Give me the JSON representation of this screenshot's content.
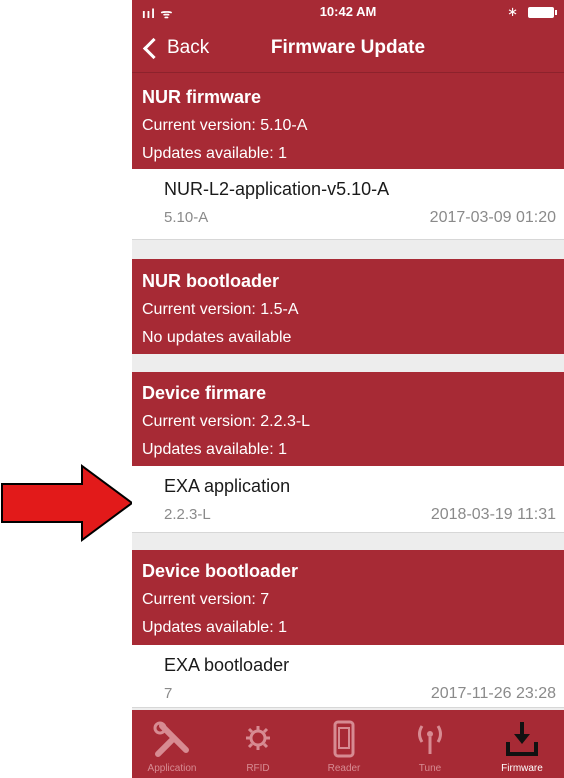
{
  "status": {
    "signal": "ııl ᯤ",
    "time": "10:42 AM",
    "bluetooth": "∗"
  },
  "nav": {
    "back_label": "Back",
    "title": "Firmware Update"
  },
  "sections": [
    {
      "title": "NUR firmware",
      "version_line": "Current version: 5.10-A",
      "updates_line": "Updates available: 1",
      "item": {
        "name": "NUR-L2-application-v5.10-A",
        "version": "5.10-A",
        "date": "2017-03-09 01:20"
      }
    },
    {
      "title": "NUR bootloader",
      "version_line": "Current version: 1.5-A",
      "updates_line": "No updates available"
    },
    {
      "title": "Device firmare",
      "version_line": "Current version: 2.2.3-L",
      "updates_line": "Updates available: 1",
      "item": {
        "name": "EXA application",
        "version": "2.2.3-L",
        "date": "2018-03-19 11:31"
      }
    },
    {
      "title": "Device bootloader",
      "version_line": "Current version: 7",
      "updates_line": "Updates available: 1",
      "item": {
        "name": "EXA bootloader",
        "version": "7",
        "date": "2017-11-26 23:28"
      }
    }
  ],
  "tabs": [
    {
      "label": "Application",
      "icon": "tools-icon"
    },
    {
      "label": "RFID",
      "icon": "gear-icon"
    },
    {
      "label": "Reader",
      "icon": "phone-icon"
    },
    {
      "label": "Tune",
      "icon": "antenna-icon"
    },
    {
      "label": "Firmware",
      "icon": "download-icon",
      "active": true
    }
  ],
  "colors": {
    "brand": "#a72a35",
    "arrow": "#e21a1a"
  }
}
